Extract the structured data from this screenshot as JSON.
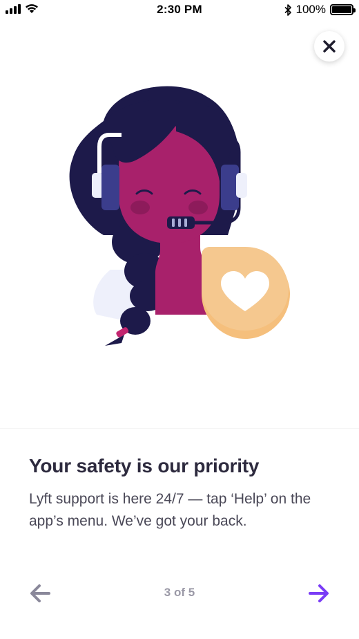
{
  "status_bar": {
    "time": "2:30 PM",
    "battery_percent": "100%",
    "signal_icon": "cellular-signal-icon",
    "wifi_icon": "wifi-icon",
    "bluetooth_icon": "bluetooth-icon",
    "battery_icon": "battery-icon",
    "battery_level": 1.0
  },
  "close_button": {
    "icon": "close-icon"
  },
  "illustration": {
    "subject": "support-agent-with-headset",
    "badge_icon": "heart-icon"
  },
  "content": {
    "headline": "Your safety is our priority",
    "body": "Lyft support is here 24/7 — tap ‘Help’ on the app’s menu. We’ve got your back."
  },
  "pager": {
    "indicator": "3 of 5",
    "back_icon": "arrow-left-icon",
    "next_icon": "arrow-right-icon"
  },
  "colors": {
    "headline": "#2d2a3e",
    "body": "#4a4857",
    "next_arrow": "#7a3cf6",
    "back_arrow": "#8a889a",
    "hair": "#1d1a4a",
    "skin": "#a8216b",
    "badge": "#f5c88f"
  }
}
